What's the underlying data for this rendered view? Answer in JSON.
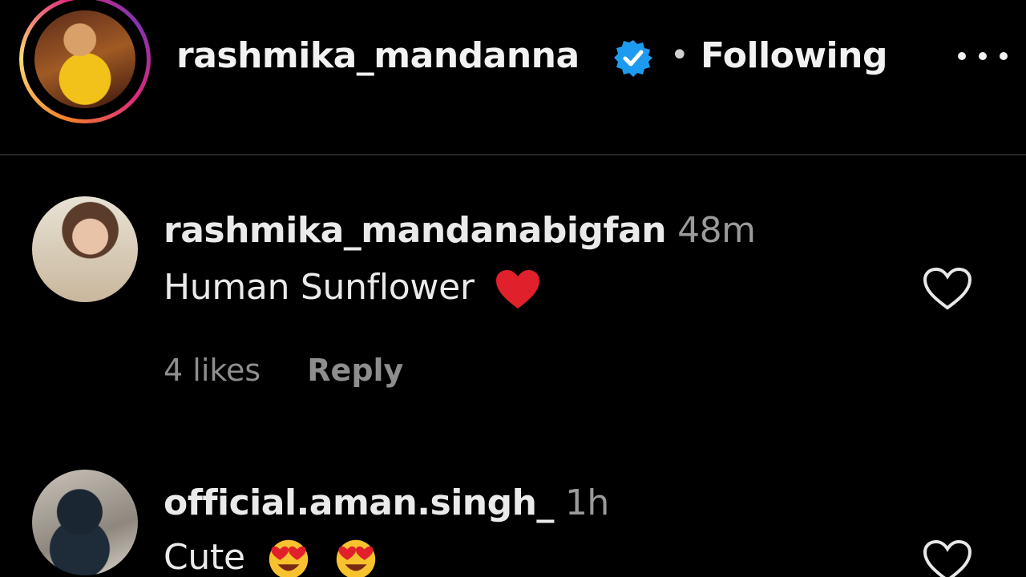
{
  "header": {
    "username": "rashmika_mandanna",
    "separator": "•",
    "follow_label": "Following",
    "more_label": "•••"
  },
  "comments": [
    {
      "username": "rashmika_mandanabigfan",
      "time": "48m",
      "text": "Human Sunflower",
      "likes": "4 likes",
      "reply_label": "Reply"
    },
    {
      "username": "official.aman.singh_",
      "time": "1h",
      "text": "Cute"
    }
  ],
  "colors": {
    "background": "#000000",
    "verified": "#1d9bf0",
    "heart_emoji": "#e0202b",
    "divider": "#262626"
  },
  "icons": [
    "verified-badge-icon",
    "more-options-icon",
    "heart-emoji-icon",
    "heart-eyes-emoji-icon",
    "like-heart-icon"
  ]
}
